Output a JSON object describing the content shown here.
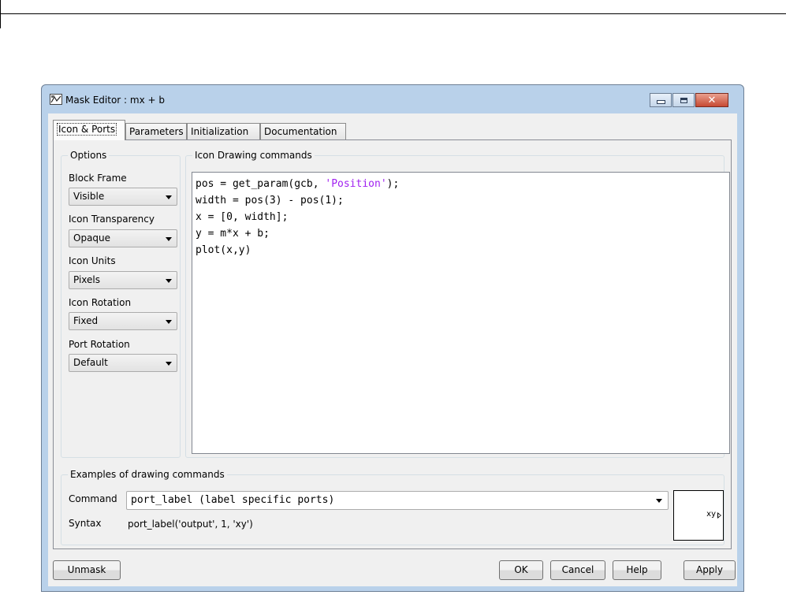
{
  "window": {
    "title": "Mask Editor : mx + b",
    "icon": "mask-editor-icon"
  },
  "tabs": [
    "Icon & Ports",
    "Parameters",
    "Initialization",
    "Documentation"
  ],
  "options": {
    "legend": "Options",
    "fields": [
      {
        "label": "Block Frame",
        "value": "Visible"
      },
      {
        "label": "Icon Transparency",
        "value": "Opaque"
      },
      {
        "label": "Icon Units",
        "value": "Pixels"
      },
      {
        "label": "Icon Rotation",
        "value": "Fixed"
      },
      {
        "label": "Port Rotation",
        "value": "Default"
      }
    ]
  },
  "drawing": {
    "legend": "Icon Drawing commands",
    "lines": [
      "pos = get_param(gcb, ",
      "width = pos(3) - pos(1);",
      "x = [0, width];",
      "y = m*x + b;",
      "plot(x,y)"
    ],
    "line1_string": "'Position'",
    "line1_end": ");",
    "string_color": "#a020f0"
  },
  "examples": {
    "legend": "Examples of drawing commands",
    "command_label": "Command",
    "command_value": "port_label (label specific ports)",
    "syntax_label": "Syntax",
    "syntax_value": "port_label('output', 1, 'xy')",
    "preview_label": "xy"
  },
  "buttons": {
    "unmask": "Unmask",
    "ok": "OK",
    "cancel": "Cancel",
    "help": "Help",
    "apply": "Apply"
  }
}
